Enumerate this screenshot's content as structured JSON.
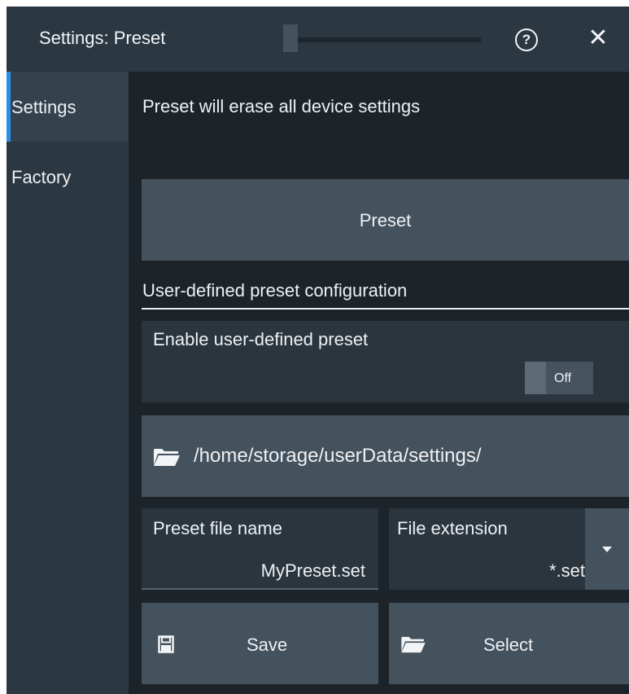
{
  "window": {
    "title": "Settings: Preset",
    "help_icon": "question-circle-icon",
    "close_icon": "close-x-icon",
    "help_glyph": "?",
    "close_glyph": "✕"
  },
  "sidebar": {
    "items": [
      {
        "label": "Settings",
        "active": true
      },
      {
        "label": "Factory",
        "active": false
      }
    ]
  },
  "main": {
    "warning_text": "Preset will erase all device settings",
    "preset_button_label": "Preset",
    "user_section_title": "User-defined preset configuration",
    "enable_label": "Enable user-defined preset",
    "enable_state": "Off",
    "path": "/home/storage/userData/settings/",
    "file_name_label": "Preset file name",
    "file_name_value": "MyPreset.set",
    "extension_label": "File extension",
    "extension_value": "*.set",
    "save_label": "Save",
    "select_label": "Select"
  },
  "colors": {
    "background": "#1c2329",
    "titlebar": "#2b3842",
    "button": "#44525d",
    "accent": "#2a8ee8"
  }
}
